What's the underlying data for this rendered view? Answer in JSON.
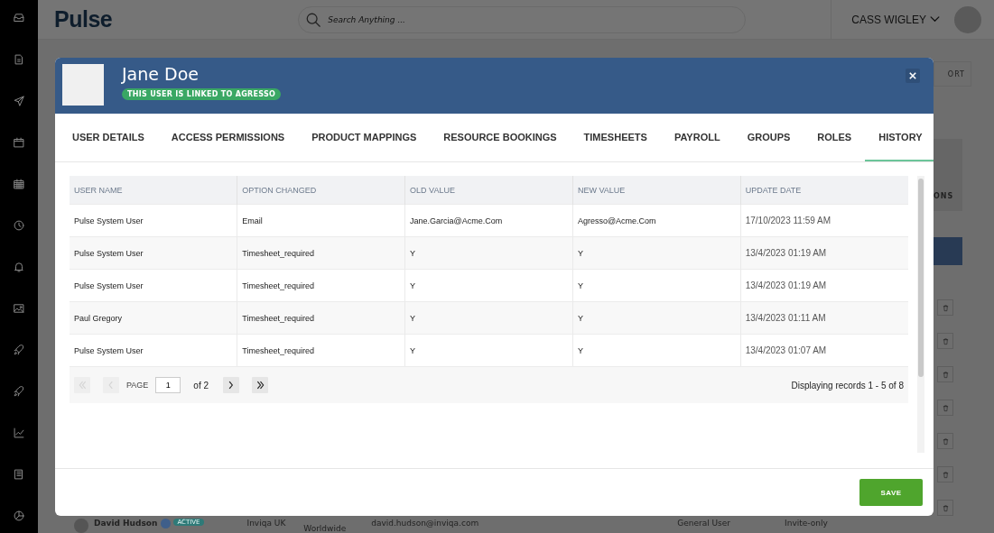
{
  "sidebar": {
    "items": [
      {
        "kind": "inbox"
      },
      {
        "kind": "document"
      },
      {
        "kind": "send"
      },
      {
        "kind": "calendar"
      },
      {
        "kind": "calendar-grid"
      },
      {
        "kind": "clock"
      },
      {
        "kind": "bell"
      },
      {
        "kind": "image"
      },
      {
        "kind": "rocket"
      },
      {
        "kind": "rocket"
      },
      {
        "kind": "chart"
      },
      {
        "kind": "book"
      },
      {
        "kind": "pie"
      }
    ]
  },
  "topbar": {
    "logo": "Pulse",
    "search": {
      "placeholder": "Search Anything ..."
    },
    "user_name": "CASS WIGLEY"
  },
  "background": {
    "button_fragment": "ORT",
    "column_fragment": "ONS",
    "row": {
      "name": "David Hudson",
      "status": "ACTIVE",
      "company": "Inviqa UK",
      "region": "Worldwide",
      "email": "david.hudson@inviqa.com",
      "role": "General User",
      "access": "Invite-only"
    }
  },
  "dialog": {
    "name": "Jane Doe",
    "badge": "THIS USER IS LINKED TO AGRESSO",
    "tabs": [
      {
        "label": "USER DETAILS",
        "selected": false
      },
      {
        "label": "ACCESS PERMISSIONS",
        "selected": false
      },
      {
        "label": "PRODUCT MAPPINGS",
        "selected": false
      },
      {
        "label": "RESOURCE BOOKINGS",
        "selected": false
      },
      {
        "label": "TIMESHEETS",
        "selected": false
      },
      {
        "label": "PAYROLL",
        "selected": false
      },
      {
        "label": "GROUPS",
        "selected": false
      },
      {
        "label": "ROLES",
        "selected": false
      },
      {
        "label": "HISTORY",
        "selected": true
      }
    ],
    "table": {
      "columns": [
        "USER NAME",
        "OPTION CHANGED",
        "OLD VALUE",
        "NEW VALUE",
        "UPDATE DATE"
      ],
      "rows": [
        [
          "Pulse System User",
          "Email",
          "Jane.Garcia@Acme.Com",
          "Agresso@Acme.Com",
          "17/10/2023 11:59 AM"
        ],
        [
          "Pulse System User",
          "Timesheet_required",
          "Y",
          "Y",
          "13/4/2023 01:19 AM"
        ],
        [
          "Pulse System User",
          "Timesheet_required",
          "Y",
          "Y",
          "13/4/2023 01:19 AM"
        ],
        [
          "Paul Gregory",
          "Timesheet_required",
          "Y",
          "Y",
          "13/4/2023 01:11 AM"
        ],
        [
          "Pulse System User",
          "Timesheet_required",
          "Y",
          "Y",
          "13/4/2023 01:07 AM"
        ]
      ]
    },
    "pagination": {
      "nav": [
        {
          "kind": "first",
          "disabled": true
        },
        {
          "kind": "prev",
          "disabled": true
        },
        {
          "kind": "next",
          "disabled": false
        },
        {
          "kind": "last",
          "disabled": false
        }
      ],
      "page_label": "PAGE",
      "page": "1",
      "of": "of 2",
      "summary": "Displaying records 1 - 5 of 8"
    },
    "save": "SAVE"
  }
}
